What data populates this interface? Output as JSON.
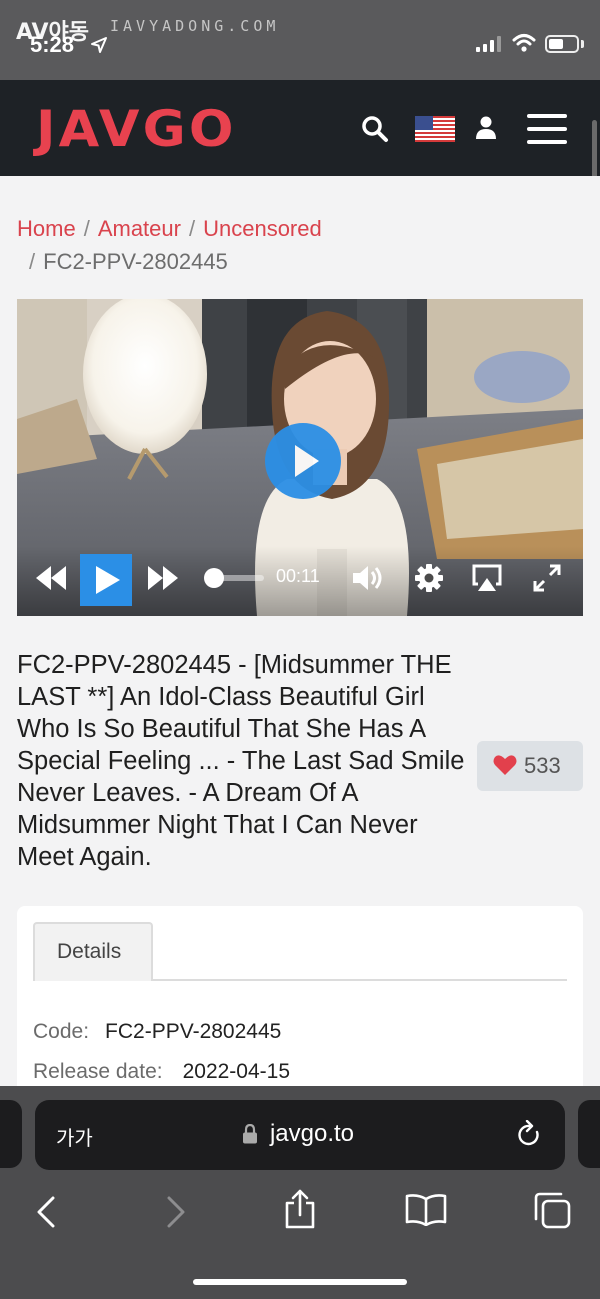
{
  "status_bar": {
    "time": "5:28",
    "watermark_brand": "AV야동",
    "watermark_url": "IAVYADONG.COM",
    "battery_level": 0.55
  },
  "header": {
    "logo": "JAVGO",
    "icons": [
      "search-icon",
      "us-flag-icon",
      "user-icon",
      "menu-icon"
    ],
    "brand_color": "#e8424f"
  },
  "breadcrumb": {
    "items": [
      "Home",
      "Amateur",
      "Uncensored"
    ],
    "separator": "/",
    "current": "FC2-PPV-2802445"
  },
  "player": {
    "time": "00:11",
    "progress": 0.05,
    "controls": [
      "rewind-icon",
      "play-icon",
      "forward-icon",
      "volume-icon",
      "settings-icon",
      "airplay-icon",
      "fullscreen-icon"
    ],
    "accent": "#2b8fe6"
  },
  "video": {
    "title": "FC2-PPV-2802445 - [Midsummer THE LAST **] An Idol-Class Beautiful Girl Who Is So Beautiful That She Has A Special Feeling ... - The Last Sad Smile Never Leaves. - A Dream Of A Midsummer Night That I Can Never Meet Again.",
    "likes": "533"
  },
  "details": {
    "tab_label": "Details",
    "rows": [
      {
        "key": "Code:",
        "value": "FC2-PPV-2802445"
      },
      {
        "key": "Release date:",
        "value": "2022-04-15"
      }
    ]
  },
  "safari": {
    "text_size_label": "가가",
    "url": "javgo.to"
  }
}
